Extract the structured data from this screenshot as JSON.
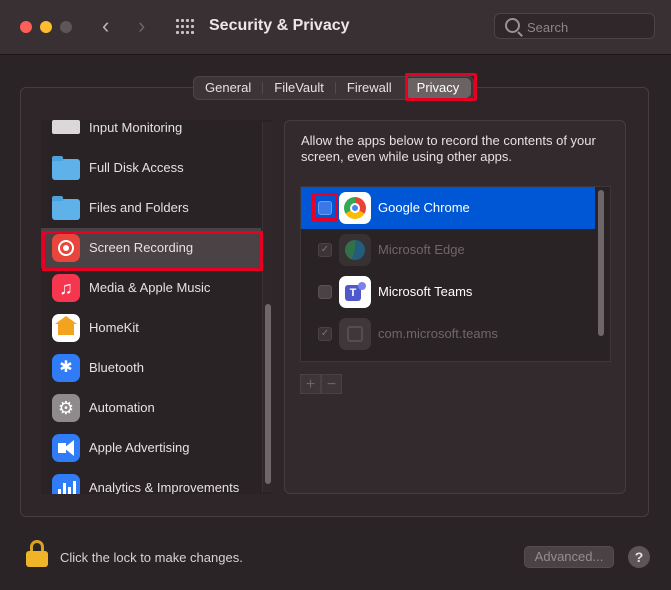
{
  "window": {
    "title": "Security & Privacy"
  },
  "search": {
    "placeholder": "Search"
  },
  "tabs": [
    {
      "label": "General"
    },
    {
      "label": "FileVault"
    },
    {
      "label": "Firewall"
    },
    {
      "label": "Privacy",
      "selected": true
    }
  ],
  "sidebar": {
    "items": [
      {
        "label": "Input Monitoring",
        "icon": "keyboard-icon"
      },
      {
        "label": "Full Disk Access",
        "icon": "folder-icon"
      },
      {
        "label": "Files and Folders",
        "icon": "folder-icon"
      },
      {
        "label": "Screen Recording",
        "icon": "screen-recording-icon",
        "selected": true
      },
      {
        "label": "Media & Apple Music",
        "icon": "music-note-icon"
      },
      {
        "label": "HomeKit",
        "icon": "home-icon"
      },
      {
        "label": "Bluetooth",
        "icon": "bluetooth-icon"
      },
      {
        "label": "Automation",
        "icon": "gear-icon"
      },
      {
        "label": "Apple Advertising",
        "icon": "megaphone-icon"
      },
      {
        "label": "Analytics & Improvements",
        "icon": "bar-chart-icon"
      }
    ]
  },
  "main": {
    "description": "Allow the apps below to record the contents of your screen, even while using other apps.",
    "apps": [
      {
        "name": "Google Chrome",
        "checked": false,
        "selected": true,
        "enabled": true,
        "icon": "chrome-icon"
      },
      {
        "name": "Microsoft Edge",
        "checked": true,
        "selected": false,
        "enabled": false,
        "icon": "edge-icon"
      },
      {
        "name": "Microsoft Teams",
        "checked": false,
        "selected": false,
        "enabled": true,
        "icon": "teams-icon"
      },
      {
        "name": "com.microsoft.teams",
        "checked": true,
        "selected": false,
        "enabled": false,
        "icon": "generic-app-icon"
      }
    ],
    "add_label": "+",
    "remove_label": "−"
  },
  "footer": {
    "lock_text": "Click the lock to make changes.",
    "advanced_label": "Advanced...",
    "help_label": "?"
  },
  "colors": {
    "highlight_box": "#e60023",
    "selection_blue": "#0057d6",
    "background": "#2b2426"
  }
}
